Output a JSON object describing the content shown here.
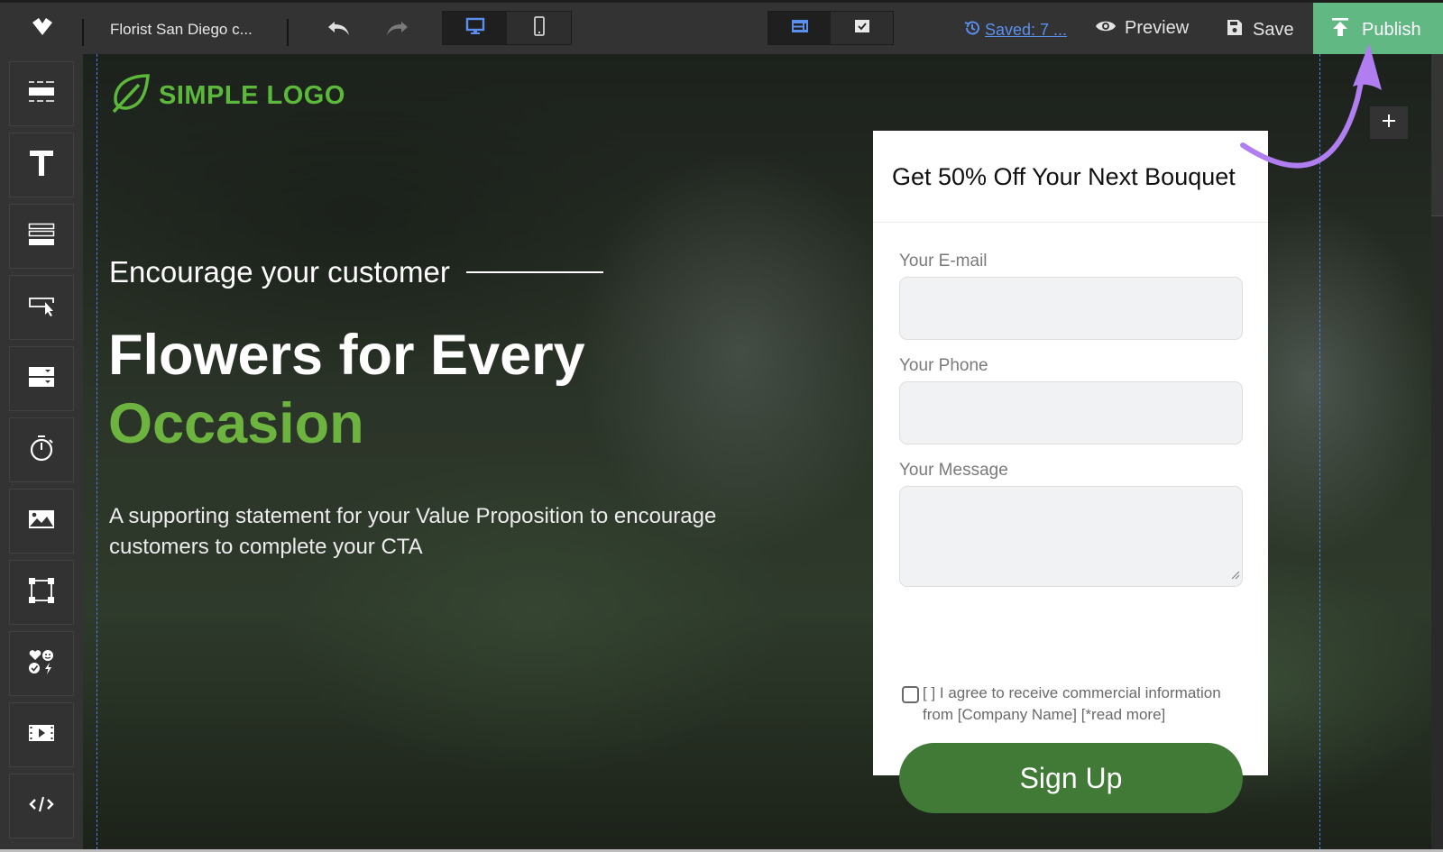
{
  "toolbar": {
    "brand_icon": "app-logo-icon",
    "doc_title": "Florist San Diego c...",
    "undo_icon": "undo-icon",
    "redo_icon": "redo-icon",
    "device_toggle": [
      {
        "name": "desktop",
        "icon": "desktop-icon",
        "active": true
      },
      {
        "name": "mobile",
        "icon": "mobile-icon",
        "active": false
      }
    ],
    "mode_toggle": [
      {
        "name": "layout",
        "icon": "layout-icon",
        "active": true
      },
      {
        "name": "checklist",
        "icon": "checkbox-icon",
        "active": false
      }
    ],
    "saved_label": "Saved: 7 ...",
    "preview_label": "Preview",
    "save_label": "Save",
    "publish_label": "Publish",
    "accent_color": "#5a8ff0",
    "publish_color": "#62b883"
  },
  "sidebar": {
    "tools": [
      {
        "name": "section",
        "icon": "section-icon"
      },
      {
        "name": "text",
        "icon": "text-icon"
      },
      {
        "name": "form",
        "icon": "form-icon"
      },
      {
        "name": "button",
        "icon": "button-icon"
      },
      {
        "name": "dropdown",
        "icon": "dropdown-icon"
      },
      {
        "name": "timer",
        "icon": "stopwatch-icon"
      },
      {
        "name": "image",
        "icon": "image-icon"
      },
      {
        "name": "shape",
        "icon": "shape-icon"
      },
      {
        "name": "icons",
        "icon": "icons-icon"
      },
      {
        "name": "video",
        "icon": "video-icon"
      },
      {
        "name": "custom-html",
        "icon": "code-icon"
      }
    ]
  },
  "canvas": {
    "logo_text": "SIMPLE LOGO",
    "kicker": "Encourage your customer",
    "headline_line1": "Flowers for Every",
    "headline_accent": "Occasion",
    "support_text": "A supporting statement for your Value Proposition to encourage customers to complete your CTA",
    "brand_green": "#6db33f"
  },
  "form": {
    "title": "Get 50% Off Your Next Bouquet",
    "fields": [
      {
        "label": "Your E-mail",
        "value": "",
        "placeholder": ""
      },
      {
        "label": "Your Phone",
        "value": "",
        "placeholder": ""
      },
      {
        "label": "Your Message",
        "value": "",
        "placeholder": ""
      }
    ],
    "consent_checked": false,
    "consent_text": "[ ] I agree to receive commercial information from [Company Name] [*read more]",
    "submit_label": "Sign Up",
    "button_color": "#417a36"
  },
  "add_section_label": "+",
  "annotation": {
    "color": "#b07ef0",
    "points_to": "publish-button"
  }
}
